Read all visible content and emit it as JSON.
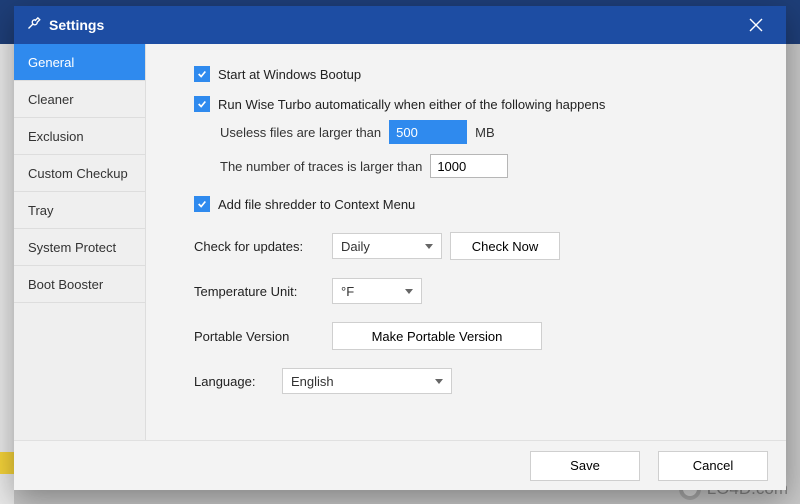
{
  "title": "Settings",
  "watermark": "LO4D.com",
  "sidebar": {
    "items": [
      {
        "label": "General",
        "active": true
      },
      {
        "label": "Cleaner",
        "active": false
      },
      {
        "label": "Exclusion",
        "active": false
      },
      {
        "label": "Custom Checkup",
        "active": false
      },
      {
        "label": "Tray",
        "active": false
      },
      {
        "label": "System Protect",
        "active": false
      },
      {
        "label": "Boot Booster",
        "active": false
      }
    ]
  },
  "main": {
    "startAtBoot": {
      "label": "Start at Windows Bootup",
      "checked": true
    },
    "autoRun": {
      "label": "Run Wise Turbo automatically when either of the following happens",
      "checked": true,
      "rule1_prefix": "Useless files are larger than",
      "rule1_value": "500",
      "rule1_unit": "MB",
      "rule2_prefix": "The number of traces is larger than",
      "rule2_value": "1000"
    },
    "shredder": {
      "label": "Add file shredder to Context Menu",
      "checked": true
    },
    "updates": {
      "label": "Check for updates:",
      "value": "Daily",
      "check_now": "Check Now"
    },
    "temp": {
      "label": "Temperature Unit:",
      "value": "°F"
    },
    "portable": {
      "label": "Portable Version",
      "button": "Make Portable Version"
    },
    "language": {
      "label": "Language:",
      "value": "English"
    }
  },
  "footer": {
    "save": "Save",
    "cancel": "Cancel"
  }
}
